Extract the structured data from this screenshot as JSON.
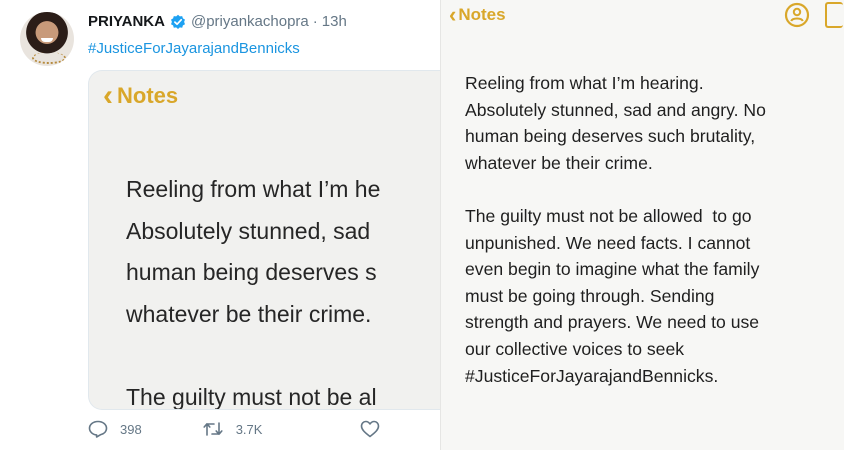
{
  "tweet": {
    "display_name": "PRIYANKA",
    "handle": "@priyankachopra",
    "separator": "·",
    "time": "13h",
    "hashtag": "#JusticeForJayarajandBennicks",
    "verified_color": "#1da1f2",
    "counts": {
      "replies": "398",
      "retweets": "3.7K"
    },
    "icons": [
      "reply-icon",
      "retweet-icon",
      "like-icon"
    ]
  },
  "card": {
    "back_label": "Notes",
    "lines": [
      "Reeling from what I’m he",
      "Absolutely stunned, sad",
      "human being deserves s",
      "whatever be their crime.",
      "",
      "The guilty must not be al"
    ]
  },
  "notes": {
    "back_label": "Notes",
    "accent": "#d9a72a",
    "icons": [
      "share-person-icon",
      "compose-icon"
    ],
    "paragraph1": [
      "Reeling from what I’m hearing.",
      "Absolutely stunned, sad and angry. No",
      "human being deserves such brutality,",
      "whatever be their crime."
    ],
    "paragraph2": [
      "The guilty must not be allowed  to go",
      "unpunished. We need facts. I cannot",
      "even begin to imagine what the family",
      "must be going through. Sending",
      "strength and prayers. We need to use",
      "our collective voices to seek",
      "#JusticeForJayarajandBennicks."
    ]
  }
}
